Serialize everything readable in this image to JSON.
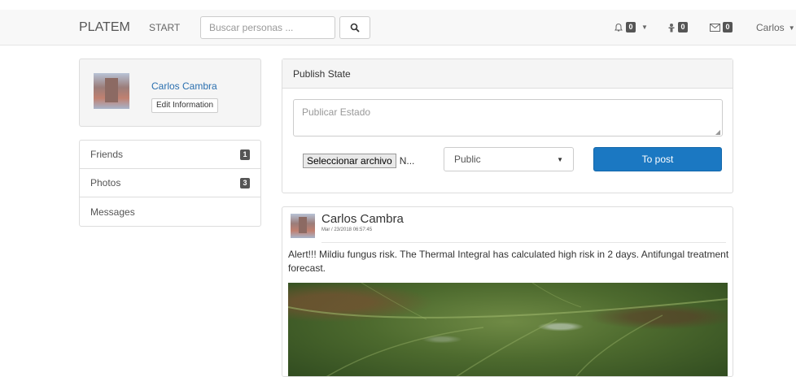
{
  "navbar": {
    "brand": "PLATEM",
    "start": "START",
    "search_placeholder": "Buscar personas ...",
    "notifications_count": "0",
    "requests_count": "0",
    "messages_count": "0",
    "user_menu": "Carlos"
  },
  "profile": {
    "name": "Carlos Cambra",
    "edit_label": "Edit Information"
  },
  "sidebar": {
    "items": [
      {
        "label": "Friends",
        "count": "1"
      },
      {
        "label": "Photos",
        "count": "3"
      },
      {
        "label": "Messages",
        "count": ""
      }
    ]
  },
  "publish": {
    "title": "Publish State",
    "placeholder": "Publicar Estado",
    "file_button": "Seleccionar archivo",
    "file_name": "N...",
    "privacy": "Public",
    "post_button": "To post"
  },
  "post": {
    "author": "Carlos Cambra",
    "date": "Mar / 23/2018 06:57:45",
    "text": "Alert!!! Mildiu fungus risk. The Thermal Integral has calculated high risk in 2 days. Antifungal treatment forecast."
  },
  "colors": {
    "accent": "#1b78c2",
    "link": "#2a6faf",
    "navbar_bg": "#f8f8f8",
    "badge": "#555555"
  }
}
